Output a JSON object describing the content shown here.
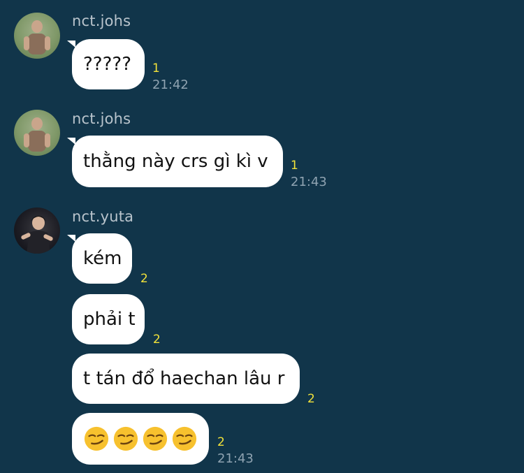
{
  "messages": [
    {
      "user": "nct.johs",
      "text": "?????",
      "count": "1",
      "time": "21:42"
    },
    {
      "user": "nct.johs",
      "text": "thằng này crs gì kì v",
      "count": "1",
      "time": "21:43"
    },
    {
      "user": "nct.yuta",
      "text": "kém",
      "count": "2",
      "time": ""
    },
    {
      "user": "",
      "text": "phải t",
      "count": "2",
      "time": ""
    },
    {
      "user": "",
      "text": "t tán đổ haechan lâu r",
      "count": "2",
      "time": ""
    },
    {
      "user": "",
      "text": "😏😏😏😏",
      "count": "2",
      "time": "21:43"
    }
  ],
  "icons": {
    "emoji": "smirking-face-emoji",
    "avatar_johs": "avatar-photo",
    "avatar_yuta": "avatar-photo"
  },
  "colors": {
    "background": "#11354a",
    "bubble": "#ffffff",
    "unread_count": "#f2e23a",
    "time": "#8fa3b1",
    "username": "#b9c4cc"
  }
}
